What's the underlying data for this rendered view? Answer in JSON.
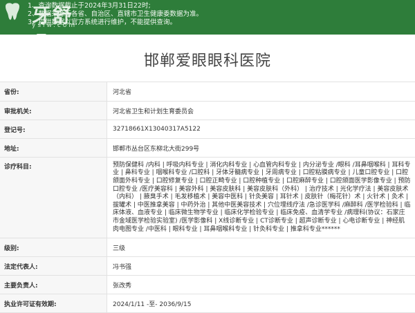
{
  "banner": {
    "logo_text": "牙舒鼎",
    "logo_url": "yslw.com",
    "notices": [
      "1、查询数据截止于2024年3月31日22时;",
      "2、数据来源于各省、自治区、直辖市卫生健康委数据为准。",
      "3、提供数据以官方系统进行维护，不能提供查询。"
    ],
    "color": "#2e7d3a"
  },
  "hospital": {
    "name": "邯郸爱眼眼科医院"
  },
  "fields": {
    "province_label": "省份:",
    "province_value": "河北省",
    "authority_label": "审批机关:",
    "authority_value": "河北省卫生和计划生育委员会",
    "reg_label": "登记号:",
    "reg_value": "32718661X13040317A5122",
    "address_label": "地址:",
    "address_value": "邯郸市丛台区东柳北大街299号",
    "subjects_label": "诊疗科目:",
    "subjects_value": "预防保健科 /内科 | 呼吸内科专业 | 消化内科专业 | 心血管内科专业 | 内分泌专业 /眼科 /耳鼻咽喉科 | 耳科专业 | 鼻科专业 | 咽喉科专业 /口腔科 | 牙体牙髓病专业 | 牙周病专业 | 口腔粘膜病专业 | 儿童口腔专业 | 口腔颌面外科专业 | 口腔修复专业 | 口腔正畸专业 | 口腔种植专业 | 口腔麻醉专业 | 口腔颌面医学影像专业 | 预防口腔专业 /医疗美容科 | 美容外科 | 美容皮肤科 | 美容皮肤科（外科） | 治疗技术 | 光化学疗法 | 美容皮肤术（内科） | 腋臭手术 | 毛发移植术 | 美容中医科 | 针灸美容 | 耳针术 | 皮肤针（梅花针）术 | 火针术 | 灸术 | 拔罐术 | 中医推拿美容 | 中药外治 | 其他中医美容技术 | 穴位埋线疗法 /急诊医学科 /麻醉科 /医学检验科 | 临床体液、血液专业 | 临床微生物学专业 | 临床化学检验专业 | 临床免疫、血清学专业 /病理科(协议：石家庄市金域医学检验实验室) /医学影像科 | X线诊断专业 | CT诊断专业 | 超声诊断专业 | 心电诊断专业 | 神经肌肉电图专业 /中医科 | 眼科专业 | 耳鼻咽喉科专业 | 针灸科专业 | 推拿科专业******",
    "level_label": "级别:",
    "level_value": "三级",
    "legal_label": "法定代表人:",
    "legal_value": "冯书强",
    "head_label": "主要负责人:",
    "head_value": "张改秀",
    "license_label": "执业许可证有效期:",
    "license_value": "2024/1/11 -至- 2036/9/15"
  }
}
